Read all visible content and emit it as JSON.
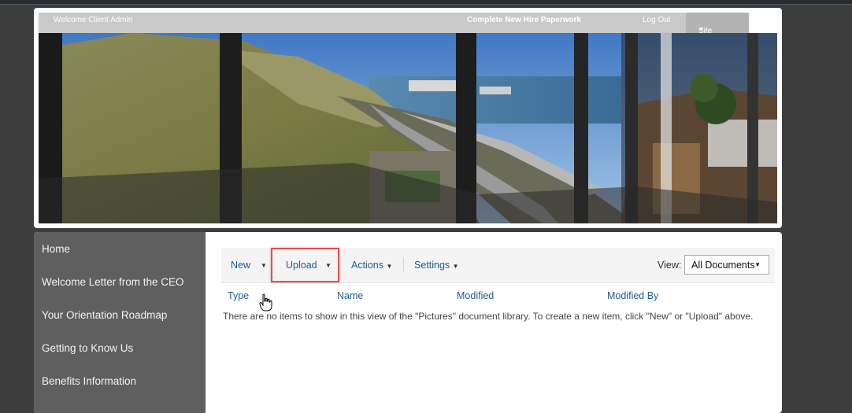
{
  "topbar": {
    "welcome": "Welcome Client Admin",
    "paperwork_link": "Complete New Hire Paperwork",
    "logout": "Log Out",
    "site_actions": "Site Actions"
  },
  "nav": {
    "items": [
      {
        "label": "Home"
      },
      {
        "label": "Welcome Letter from the CEO"
      },
      {
        "label": "Your Orientation Roadmap"
      },
      {
        "label": "Getting to Know Us"
      },
      {
        "label": "Benefits Information"
      }
    ]
  },
  "toolbar": {
    "new_label": "New",
    "upload_label": "Upload",
    "actions_label": "Actions",
    "settings_label": "Settings",
    "view_label": "View:",
    "view_selected": "All Documents",
    "arrow": "▼"
  },
  "library": {
    "columns": [
      "Type",
      "Name",
      "Modified",
      "Modified By"
    ],
    "empty_message": "There are no items to show in this view of the \"Pictures\" document library. To create a new item, click \"New\" or \"Upload\" above."
  },
  "colors": {
    "accent_link": "#1e5a96",
    "highlight_box": "#d9534f",
    "nav_bg": "#5f5f5f",
    "page_bg": "#3d3d3d"
  }
}
